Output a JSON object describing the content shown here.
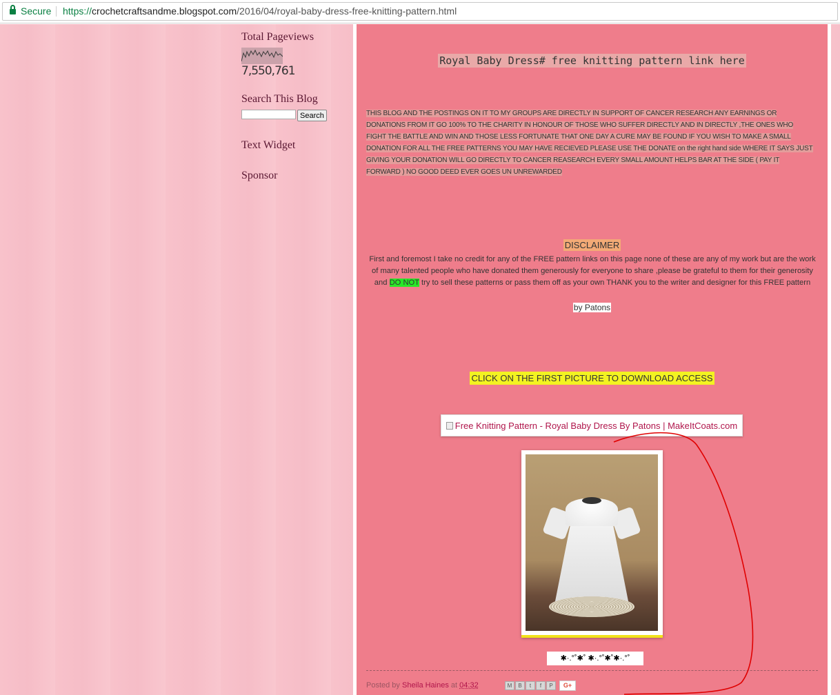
{
  "browser": {
    "secure_label": "Secure",
    "url_scheme": "https://",
    "url_host": "crochetcraftsandme.blogspot.com",
    "url_path": "/2016/04/royal-baby-dress-free-knitting-pattern.html"
  },
  "sidebar": {
    "pageviews_title": "Total Pageviews",
    "pageviews_count": "7,550,761",
    "search_title": "Search This Blog",
    "search_button": "Search",
    "search_value": "",
    "text_widget_title": "Text Widget",
    "sponsor_title": "Sponsor"
  },
  "post": {
    "title": "Royal Baby Dress# free knitting  pattern link here",
    "support_text": "THIS BLOG AND THE POSTINGS ON IT TO MY GROUPS ARE DIRECTLY IN SUPPORT OF CANCER RESEARCH ANY EARNINGS OR DONATIONS FROM IT GO 100% TO THE CHARITY IN HONOUR OF THOSE WHO SUFFER DIRECTLY AND IN DIRECTLY ,THE ONES WHO FIGHT THE BATTLE AND WIN AND THOSE LESS FORTUNATE THAT ONE DAY A CURE MAY BE FOUND IF YOU WISH TO MAKE A SMALL DONATION FOR ALL THE FREE PATTERNS YOU MAY HAVE RECIEVED PLEASE USE THE DONATE on the right hand side WHERE IT SAYS JUST GIVING YOUR DONATION WILL GO DIRECTLY TO CANCER REASEARCH EVERY SMALL AMOUNT HELPS  BAR AT THE SIDE ( PAY IT FORWARD ) NO GOOD DEED EVER GOES UN UNREWARDED",
    "disclaimer_title": "DISCLAIMER",
    "disclaimer_part1": "First and foremost I take no credit for any of the FREE pattern links on this page none of these are any of my work but are the work of many talented people who have donated them generously for everyone to share ,please be grateful to them for their generosity and ",
    "disclaimer_highlight": "DO NOT",
    "disclaimer_part2": " try to sell these patterns or pass them off as your own THANK you to the writer and designer for this FREE pattern",
    "byline": "by Patons",
    "cta": "CLICK ON THE FIRST PICTURE TO DOWNLOAD ACCESS",
    "image_link_alt": "Free Knitting Pattern - Royal Baby Dress By Patons | MakeItCoats.com",
    "glyph_divider": "✱·.°˚✱˚ ✱·.°˚✱˚✱·.°˚",
    "footer_posted_by": "Posted by ",
    "footer_author": "Sheila Haines",
    "footer_at": " at ",
    "footer_time": "04:32",
    "share_gplus": "G+"
  },
  "colors": {
    "main_bg": "#ef7d8b",
    "sidebar_bg": "#f8c2cb",
    "cta_highlight": "#f3f321",
    "green_highlight": "#28e828",
    "disclaimer_highlight": "#f3aa76",
    "annotation_red": "#e00000"
  },
  "icons": [
    "lock-icon",
    "email-share-icon",
    "blog-share-icon",
    "twitter-share-icon",
    "facebook-share-icon",
    "pinterest-share-icon"
  ]
}
